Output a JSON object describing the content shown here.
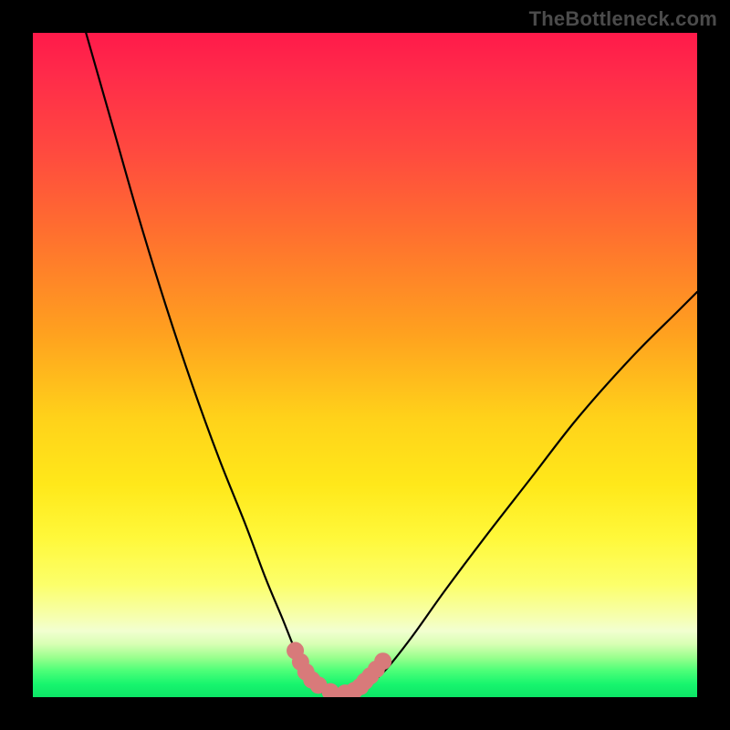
{
  "watermark": "TheBottleneck.com",
  "colors": {
    "background": "#000000",
    "curve": "#000000",
    "marker": "#d87a7a",
    "gradient_top": "#ff1a4a",
    "gradient_mid": "#ffe81a",
    "gradient_bottom": "#0ce566"
  },
  "chart_data": {
    "type": "line",
    "title": "",
    "xlabel": "",
    "ylabel": "",
    "xlim": [
      0,
      100
    ],
    "ylim": [
      0,
      100
    ],
    "annotations": [
      "TheBottleneck.com"
    ],
    "description": "Bottleneck-style V curve: a steep descending left limb from top-left, a short flat trough near the bottom (optimal zone), and a shallower ascending right limb toward upper-right. Background gradient encodes severity (red=high at top, green=low at bottom). Salmon markers highlight the transition into and out of the trough.",
    "series": [
      {
        "name": "left-descent",
        "x": [
          8,
          12,
          16,
          20,
          24,
          28,
          32,
          35,
          37.5,
          39.5,
          41,
          42
        ],
        "y": [
          100,
          86,
          72,
          59,
          47,
          36,
          26,
          18,
          12,
          7,
          3.5,
          1.5
        ]
      },
      {
        "name": "trough",
        "x": [
          42,
          44,
          46,
          48,
          50
        ],
        "y": [
          1.5,
          0.6,
          0.4,
          0.6,
          1.5
        ]
      },
      {
        "name": "right-ascent",
        "x": [
          50,
          53,
          57,
          62,
          68,
          75,
          82,
          90,
          97,
          100
        ],
        "y": [
          1.5,
          4,
          9,
          16,
          24,
          33,
          42,
          51,
          58,
          61
        ]
      }
    ],
    "highlighted_points": {
      "name": "transition-markers",
      "x": [
        39.5,
        40.3,
        41.1,
        42,
        43,
        44.8,
        47,
        48.4,
        49.3,
        50,
        50.8,
        51.7,
        52.7
      ],
      "y": [
        7,
        5.3,
        3.8,
        2.6,
        1.8,
        0.8,
        0.6,
        1.0,
        1.6,
        2.4,
        3.2,
        4.2,
        5.4
      ]
    }
  }
}
